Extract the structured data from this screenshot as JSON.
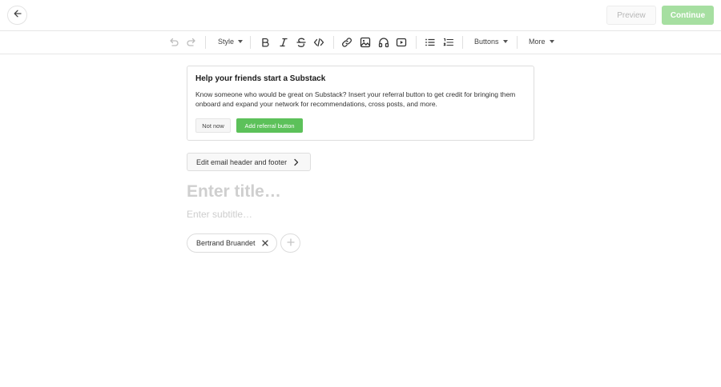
{
  "header": {
    "back_icon": "arrow-left-icon",
    "preview_label": "Preview",
    "continue_label": "Continue"
  },
  "toolbar": {
    "style_label": "Style",
    "buttons_label": "Buttons",
    "more_label": "More",
    "icons": [
      "undo-icon",
      "redo-icon",
      "bold-icon",
      "italic-icon",
      "strikethrough-icon",
      "code-icon",
      "link-icon",
      "image-icon",
      "audio-icon",
      "video-icon",
      "bullet-list-icon",
      "numbered-list-icon"
    ]
  },
  "promo": {
    "title": "Help your friends start a Substack",
    "body": "Know someone who would be great on Substack? Insert your referral button to get credit for bringing them onboard and expand your network for recommendations, cross posts, and more.",
    "not_now_label": "Not now",
    "add_referral_label": "Add referral button"
  },
  "email_settings": {
    "label": "Edit email header and footer"
  },
  "editor": {
    "title_placeholder": "Enter title…",
    "subtitle_placeholder": "Enter subtitle…"
  },
  "authors": {
    "items": [
      {
        "name": "Bertrand Bruandet"
      }
    ]
  },
  "colors": {
    "accent_green": "#5cc15a",
    "continue_disabled": "#a6dfa1"
  }
}
